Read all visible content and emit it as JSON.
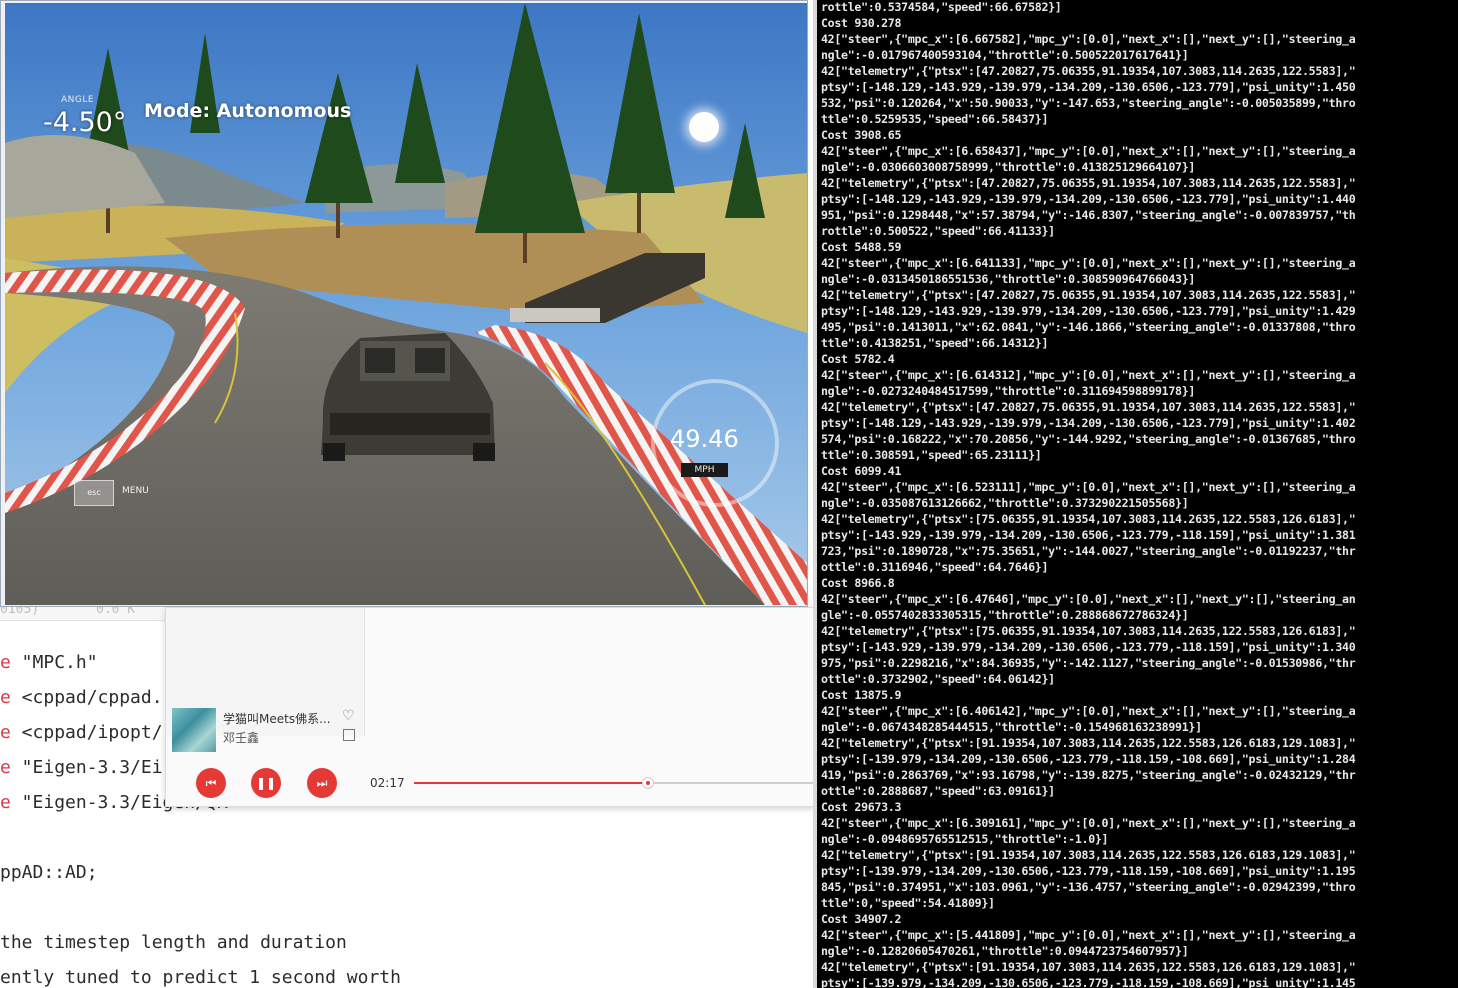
{
  "editor": {
    "topline_left": "0105)",
    "topline_mid": "0.0 K",
    "code_lines": [
      {
        "kw": "e",
        "rest": " \"MPC.h\""
      },
      {
        "kw": "e",
        "rest": " <cppad/cppad."
      },
      {
        "kw": "e",
        "rest": " <cppad/ipopt/"
      },
      {
        "kw": "e",
        "rest": " \"Eigen-3.3/Ei"
      },
      {
        "kw": "e",
        "rest": " \"Eigen-3.3/Eigen/QR"
      },
      {
        "kw": "",
        "rest": ""
      },
      {
        "kw": "",
        "rest": "ppAD::AD;"
      },
      {
        "kw": "",
        "rest": ""
      },
      {
        "kw": "",
        "rest": "the timestep length and duration"
      },
      {
        "kw": "",
        "rest": "ently tuned to predict 1 second worth"
      }
    ]
  },
  "player": {
    "song_title": "学猫叫Meets佛系...",
    "artist": "邓壬鑫",
    "heart_icon": "♡",
    "prev_icon": "⏮",
    "pause_icon": "❚❚",
    "next_icon": "⏭",
    "elapsed": "02:17",
    "progress": 0.585,
    "accent_color": "#e53935"
  },
  "simulator": {
    "angle_label": "ANGLE",
    "angle_value": "-4.50°",
    "mode_text": "Mode: Autonomous",
    "speed_value": "49.46",
    "speed_unit": "MPH",
    "esc_label": "esc",
    "menu_label": "MENU"
  },
  "terminal": {
    "text": "rottle\":0.5374584,\"speed\":66.67582}]\nCost 930.278\n42[\"steer\",{\"mpc_x\":[6.667582],\"mpc_y\":[0.0],\"next_x\":[],\"next_y\":[],\"steering_a\nngle\":-0.017967400593104,\"throttle\":0.500522017617641}]\n42[\"telemetry\",{\"ptsx\":[47.20827,75.06355,91.19354,107.3083,114.2635,122.5583],\"\nptsy\":[-148.129,-143.929,-139.979,-134.209,-130.6506,-123.779],\"psi_unity\":1.450\n532,\"psi\":0.120264,\"x\":50.90033,\"y\":-147.653,\"steering_angle\":-0.005035899,\"thro\nttle\":0.5259535,\"speed\":66.58437}]\nCost 3908.65\n42[\"steer\",{\"mpc_x\":[6.658437],\"mpc_y\":[0.0],\"next_x\":[],\"next_y\":[],\"steering_a\nngle\":-0.0306603008758999,\"throttle\":0.413825129664107}]\n42[\"telemetry\",{\"ptsx\":[47.20827,75.06355,91.19354,107.3083,114.2635,122.5583],\"\nptsy\":[-148.129,-143.929,-139.979,-134.209,-130.6506,-123.779],\"psi_unity\":1.440\n951,\"psi\":0.1298448,\"x\":57.38794,\"y\":-146.8307,\"steering_angle\":-0.007839757,\"th\nrottle\":0.500522,\"speed\":66.41133}]\nCost 5488.59\n42[\"steer\",{\"mpc_x\":[6.641133],\"mpc_y\":[0.0],\"next_x\":[],\"next_y\":[],\"steering_a\nngle\":-0.0313450186551536,\"throttle\":0.308590964766043}]\n42[\"telemetry\",{\"ptsx\":[47.20827,75.06355,91.19354,107.3083,114.2635,122.5583],\"\nptsy\":[-148.129,-143.929,-139.979,-134.209,-130.6506,-123.779],\"psi_unity\":1.429\n495,\"psi\":0.1413011,\"x\":62.0841,\"y\":-146.1866,\"steering_angle\":-0.01337808,\"thro\nttle\":0.4138251,\"speed\":66.14312}]\nCost 5782.4\n42[\"steer\",{\"mpc_x\":[6.614312],\"mpc_y\":[0.0],\"next_x\":[],\"next_y\":[],\"steering_a\nngle\":-0.0273240484517599,\"throttle\":0.311694598899178}]\n42[\"telemetry\",{\"ptsx\":[47.20827,75.06355,91.19354,107.3083,114.2635,122.5583],\"\nptsy\":[-148.129,-143.929,-139.979,-134.209,-130.6506,-123.779],\"psi_unity\":1.402\n574,\"psi\":0.168222,\"x\":70.20856,\"y\":-144.9292,\"steering_angle\":-0.01367685,\"thro\nttle\":0.308591,\"speed\":65.23111}]\nCost 6099.41\n42[\"steer\",{\"mpc_x\":[6.523111],\"mpc_y\":[0.0],\"next_x\":[],\"next_y\":[],\"steering_a\nngle\":-0.035087613126662,\"throttle\":0.373290221505568}]\n42[\"telemetry\",{\"ptsx\":[75.06355,91.19354,107.3083,114.2635,122.5583,126.6183],\"\nptsy\":[-143.929,-139.979,-134.209,-130.6506,-123.779,-118.159],\"psi_unity\":1.381\n723,\"psi\":0.1890728,\"x\":75.35651,\"y\":-144.0027,\"steering_angle\":-0.01192237,\"thr\nottle\":0.3116946,\"speed\":64.7646}]\nCost 8966.8\n42[\"steer\",{\"mpc_x\":[6.47646],\"mpc_y\":[0.0],\"next_x\":[],\"next_y\":[],\"steering_an\ngle\":-0.0557402833305315,\"throttle\":0.288868672786324}]\n42[\"telemetry\",{\"ptsx\":[75.06355,91.19354,107.3083,114.2635,122.5583,126.6183],\"\nptsy\":[-143.929,-139.979,-134.209,-130.6506,-123.779,-118.159],\"psi_unity\":1.340\n975,\"psi\":0.2298216,\"x\":84.36935,\"y\":-142.1127,\"steering_angle\":-0.01530986,\"thr\nottle\":0.3732902,\"speed\":64.06142}]\nCost 13875.9\n42[\"steer\",{\"mpc_x\":[6.406142],\"mpc_y\":[0.0],\"next_x\":[],\"next_y\":[],\"steering_a\nngle\":-0.0674348285444515,\"throttle\":-0.154968163238991}]\n42[\"telemetry\",{\"ptsx\":[91.19354,107.3083,114.2635,122.5583,126.6183,129.1083],\"\nptsy\":[-139.979,-134.209,-130.6506,-123.779,-118.159,-108.669],\"psi_unity\":1.284\n419,\"psi\":0.2863769,\"x\":93.16798,\"y\":-139.8275,\"steering_angle\":-0.02432129,\"thr\nottle\":0.2888687,\"speed\":63.09161}]\nCost 29673.3\n42[\"steer\",{\"mpc_x\":[6.309161],\"mpc_y\":[0.0],\"next_x\":[],\"next_y\":[],\"steering_a\nngle\":-0.0948695765512515,\"throttle\":-1.0}]\n42[\"telemetry\",{\"ptsx\":[91.19354,107.3083,114.2635,122.5583,126.6183,129.1083],\"\nptsy\":[-139.979,-134.209,-130.6506,-123.779,-118.159,-108.669],\"psi_unity\":1.195\n845,\"psi\":0.374951,\"x\":103.0961,\"y\":-136.4757,\"steering_angle\":-0.02942399,\"thro\nttle\":0,\"speed\":54.41809}]\nCost 34907.2\n42[\"steer\",{\"mpc_x\":[5.441809],\"mpc_y\":[0.0],\"next_x\":[],\"next_y\":[],\"steering_a\nngle\":-0.12820605470261,\"throttle\":0.0944723754607957}]\n42[\"telemetry\",{\"ptsx\":[91.19354,107.3083,114.2635,122.5583,126.6183,129.1083],\"\nptsy\":[-139.979,-134.209,-130.6506,-123.779,-118.159,-108.669],\"psi_unity\":1.145"
  }
}
